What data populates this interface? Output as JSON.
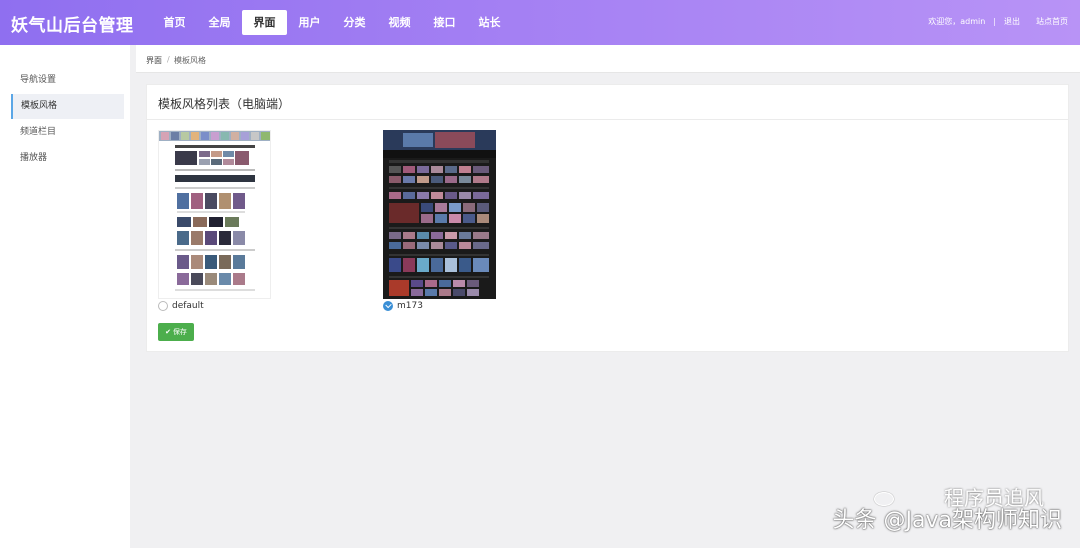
{
  "header": {
    "brand": "妖气山后台管理",
    "nav": [
      "首页",
      "全局",
      "界面",
      "用户",
      "分类",
      "视频",
      "接口",
      "站长"
    ],
    "active_nav": "界面",
    "welcome": "欢迎您，admin",
    "sep": "|",
    "logout": "退出",
    "site_home": "站点首页"
  },
  "sidebar": {
    "items": [
      "导航设置",
      "模板风格",
      "频道栏目",
      "播放器"
    ],
    "active": "模板风格"
  },
  "breadcrumb": {
    "root": "界面",
    "divider": "/",
    "current": "模板风格"
  },
  "panel": {
    "title": "模板风格列表（电脑端）",
    "templates": [
      {
        "name": "default",
        "selected": false
      },
      {
        "name": "m173",
        "selected": true
      }
    ],
    "save_label": "保存",
    "save_icon": "check-icon"
  },
  "watermark": {
    "line1": "程序员追风",
    "line2": "头条 @Java架构师知识"
  },
  "colors": {
    "header_start": "#8f6ff0",
    "header_end": "#b893f6",
    "save_button": "#4cae4c",
    "radio_checked": "#3a8fd6"
  }
}
